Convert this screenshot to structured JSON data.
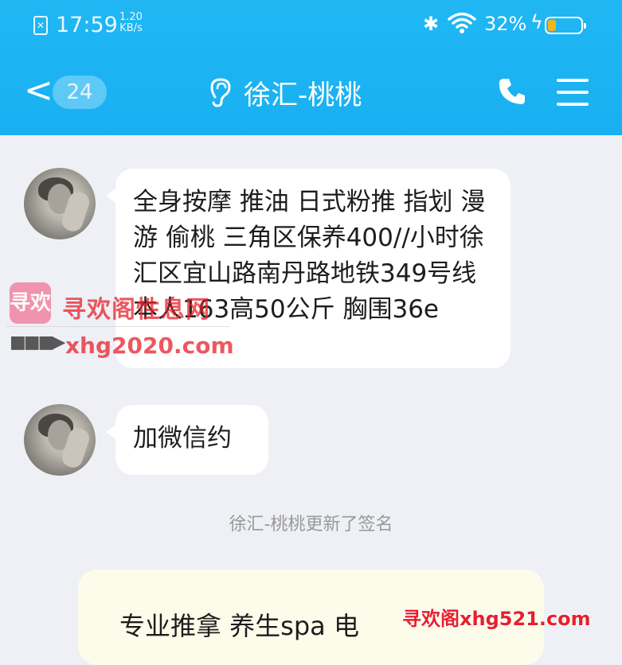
{
  "status_bar": {
    "time": "17:59",
    "net_speed_value": "1.20",
    "net_speed_unit": "KB/s",
    "battery_percent": "32%",
    "battery_level": 0.32,
    "sim_icon": "sim-x-icon",
    "bluetooth_icon": "bluetooth-icon",
    "wifi_icon": "wifi-icon",
    "charging_icon": "bolt-icon"
  },
  "header": {
    "back_glyph": "<",
    "unread_count": "24",
    "title": "徐汇-桃桃",
    "ear_icon": "ear-icon",
    "call_icon": "phone-icon",
    "menu_icon": "menu-icon",
    "background_color": "#1cb3f3"
  },
  "messages": [
    {
      "sender": "other",
      "text": "全身按摩 推油 日式粉推 指划 漫游  偷桃 三角区保养400//小时徐汇区宜山路南丹路地铁349号线 本人163高50公斤 胸围36e"
    },
    {
      "sender": "other",
      "text": "加微信约"
    }
  ],
  "system_note": "徐汇-桃桃更新了签名",
  "signature_card": {
    "text": "专业推拿 养生spa 电"
  },
  "watermarks": {
    "logo_text": "寻欢",
    "site_name": "寻欢阁性息网",
    "arrow": "■■■▶",
    "site_url": "xhg2020.com",
    "corner": "寻欢阁xhg521.com"
  }
}
